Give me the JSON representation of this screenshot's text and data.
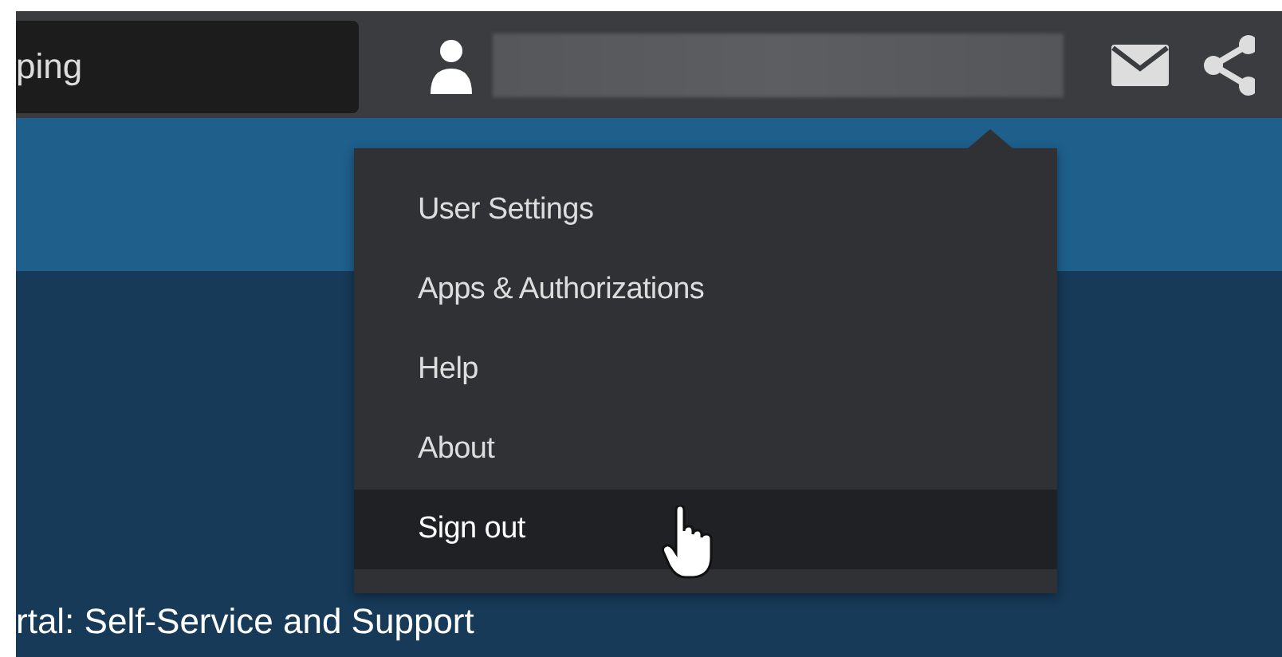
{
  "header": {
    "search": {
      "value": "ping"
    }
  },
  "user_menu": {
    "items": [
      {
        "label": "User Settings",
        "selected": false
      },
      {
        "label": "Apps & Authorizations",
        "selected": false
      },
      {
        "label": "Help",
        "selected": false
      },
      {
        "label": "About",
        "selected": false
      },
      {
        "label": "Sign out",
        "selected": true
      }
    ]
  },
  "page": {
    "heading": "rtal: Self-Service and Support"
  }
}
